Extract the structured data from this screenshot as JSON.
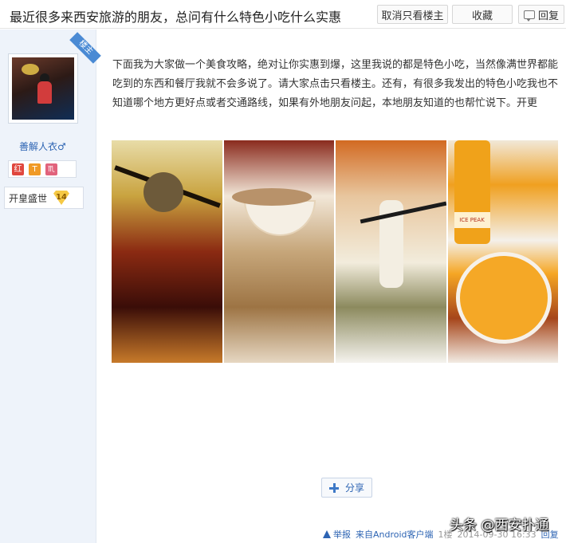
{
  "header": {
    "title": "最近很多来西安旅游的朋友，总问有什么特色小吃什么实惠",
    "only_lz_label": "取消只看楼主",
    "favorite_label": "收藏",
    "reply_label": "回复"
  },
  "author": {
    "badge": "楼主",
    "name": "善解人衣♂",
    "medals": [
      "红",
      "T",
      "♏"
    ],
    "level_name": "开皇盛世",
    "level_num": "14"
  },
  "post": {
    "text": "下面我为大家做一个美食攻略，绝对让你实惠到爆，这里我说的都是特色小吃，当然像满世界都能吃到的东西和餐厅我就不会多说了。请大家点击只看楼主。还有，有很多我发出的特色小吃我也不知道哪个地方更好点或者交通路线，如果有外地朋友问起，本地朋友知道的也帮忙说下。开更",
    "images": [
      "food-photo-1",
      "food-photo-2",
      "food-photo-3",
      "food-photo-4"
    ],
    "bottle_label": "ICE PEAK"
  },
  "share": {
    "label": "分享"
  },
  "footer": {
    "report": "举报",
    "client": "来自Android客户端",
    "floor": "1楼",
    "time": "2014-09-30 16:33",
    "reply": "回复"
  },
  "watermark": "头条 @西安扑通",
  "colors": {
    "link": "#2d64b3",
    "sidebar_bg": "#eef3fa",
    "louzhu_badge": "#4a8ad4"
  }
}
